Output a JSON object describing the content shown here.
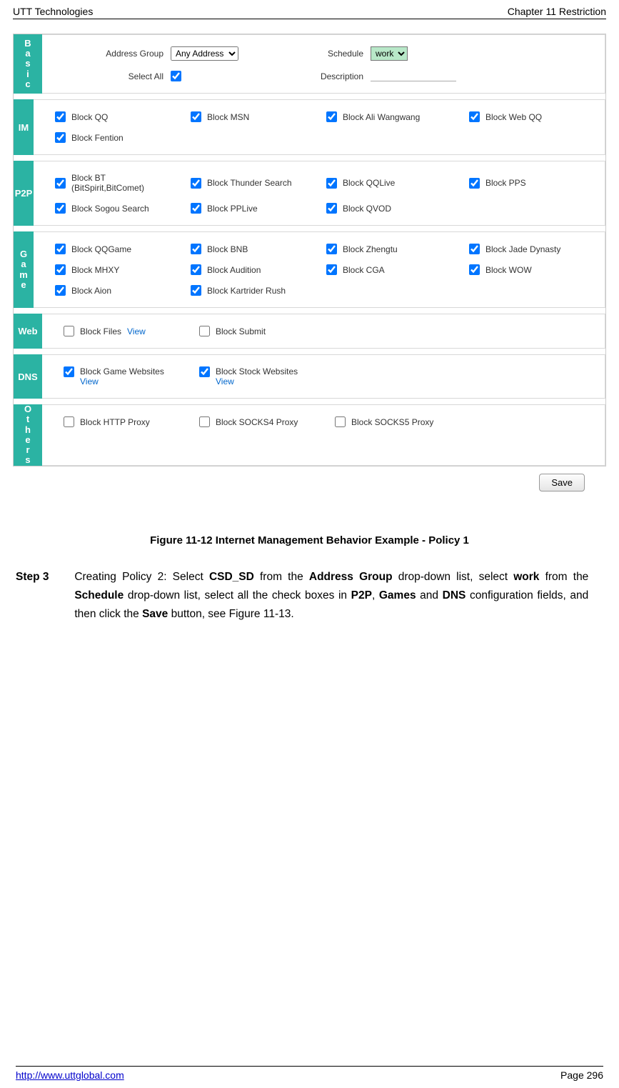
{
  "header": {
    "left": "UTT Technologies",
    "right": "Chapter 11 Restriction"
  },
  "basic": {
    "label": "Basic",
    "address_group_label": "Address Group",
    "address_group_value": "Any Address",
    "select_all_label": "Select All",
    "schedule_label": "Schedule",
    "schedule_value": "work",
    "description_label": "Description"
  },
  "sections": {
    "im": {
      "label": "IM",
      "items": [
        {
          "text": "Block QQ",
          "checked": true
        },
        {
          "text": "Block MSN",
          "checked": true
        },
        {
          "text": "Block Ali Wangwang",
          "checked": true
        },
        {
          "text": "Block Web QQ",
          "checked": true
        },
        {
          "text": "Block Fention",
          "checked": true
        }
      ]
    },
    "p2p": {
      "label": "P2P",
      "items": [
        {
          "text": "Block BT\n(BitSpirit,BitComet)",
          "checked": true
        },
        {
          "text": "Block Thunder Search",
          "checked": true
        },
        {
          "text": "Block QQLive",
          "checked": true
        },
        {
          "text": "Block PPS",
          "checked": true
        },
        {
          "text": "Block Sogou Search",
          "checked": true
        },
        {
          "text": "Block PPLive",
          "checked": true
        },
        {
          "text": "Block QVOD",
          "checked": true
        }
      ]
    },
    "game": {
      "label": "Game",
      "items": [
        {
          "text": "Block QQGame",
          "checked": true
        },
        {
          "text": "Block BNB",
          "checked": true
        },
        {
          "text": "Block Zhengtu",
          "checked": true
        },
        {
          "text": "Block Jade Dynasty",
          "checked": true
        },
        {
          "text": "Block MHXY",
          "checked": true
        },
        {
          "text": "Block Audition",
          "checked": true
        },
        {
          "text": "Block CGA",
          "checked": true
        },
        {
          "text": "Block WOW",
          "checked": true
        },
        {
          "text": "Block Aion",
          "checked": true
        },
        {
          "text": "Block Kartrider Rush",
          "checked": true
        }
      ]
    },
    "web": {
      "label": "Web",
      "items": [
        {
          "text": "Block Files",
          "checked": false,
          "link": "View"
        },
        {
          "text": "Block Submit",
          "checked": false
        }
      ]
    },
    "dns": {
      "label": "DNS",
      "items": [
        {
          "text": "Block Game Websites",
          "checked": true,
          "link": "View"
        },
        {
          "text": "Block Stock Websites",
          "checked": true,
          "link": "View"
        }
      ]
    },
    "others": {
      "label": "Others",
      "items": [
        {
          "text": "Block HTTP Proxy",
          "checked": false
        },
        {
          "text": "Block SOCKS4 Proxy",
          "checked": false
        },
        {
          "text": "Block SOCKS5 Proxy",
          "checked": false
        }
      ]
    }
  },
  "save_button": "Save",
  "figure_caption": "Figure 11-12 Internet Management Behavior Example - Policy 1",
  "step": {
    "label": "Step 3",
    "pre1": "Creating Policy 2: Select ",
    "b1": "CSD_SD",
    "mid1": " from the ",
    "b2": "Address Group",
    "mid2": " drop-down list, select ",
    "b3": "work",
    "mid3": " from the ",
    "b4": "Schedule",
    "mid4": " drop-down list, select all the check boxes in ",
    "b5": "P2P",
    "mid5": ", ",
    "b6": "Games",
    "mid6": " and ",
    "b7": "DNS",
    "mid7": " configuration fields, and then click the ",
    "b8": "Save",
    "mid8": " button, see Figure 11-13."
  },
  "footer": {
    "url": "http://www.uttglobal.com",
    "page": "Page 296"
  }
}
